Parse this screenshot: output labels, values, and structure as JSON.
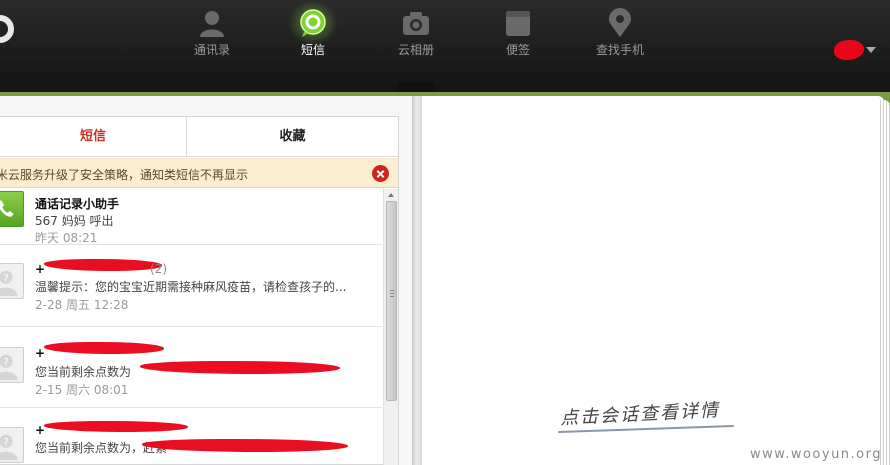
{
  "nav": {
    "items": [
      {
        "label": "通讯录",
        "icon": "person-icon"
      },
      {
        "label": "短信",
        "icon": "chat-bubble-icon",
        "active": true
      },
      {
        "label": "云相册",
        "icon": "camera-icon"
      },
      {
        "label": "便签",
        "icon": "notepad-icon"
      },
      {
        "label": "查找手机",
        "icon": "map-pin-icon"
      }
    ],
    "accent_color": "#8cdc3c"
  },
  "panel": {
    "tabs": [
      {
        "label": "短信",
        "active": true
      },
      {
        "label": "收藏",
        "active": false
      }
    ],
    "notice": "米云服务升级了安全策略，通知类短信不再显示",
    "conversations": [
      {
        "name": "通话记录小助手",
        "preview": "567 妈妈   呼出",
        "time": "昨天 08:21",
        "avatar": "phone-icon"
      },
      {
        "name": "+",
        "count": "(2)",
        "preview": "温馨提示：您的宝宝近期需接种麻风疫苗，请检查孩子的...",
        "time": "2-28 周五 12:28",
        "avatar": "unknown-contact-icon"
      },
      {
        "name": "+",
        "preview": "您当前剩余点数为",
        "time": "2-15 周六 08:01",
        "avatar": "unknown-contact-icon"
      },
      {
        "name": "+",
        "preview": "您当前剩余点数为，赶紧",
        "time": "",
        "avatar": "unknown-contact-icon"
      }
    ]
  },
  "detail": {
    "hint": "点击会话查看详情"
  },
  "watermark": "www.wooyun.org"
}
